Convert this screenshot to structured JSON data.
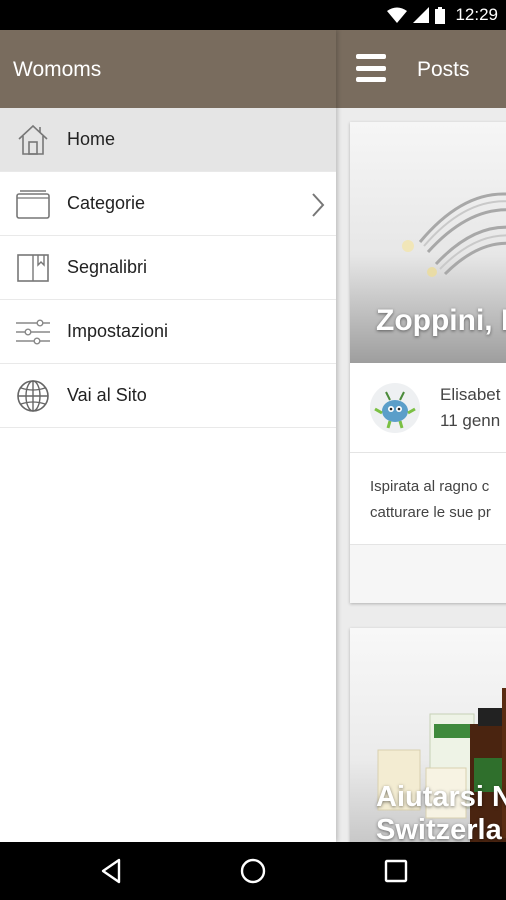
{
  "status_bar": {
    "time": "12:29",
    "icons": [
      "wifi-icon",
      "signal-icon",
      "battery-icon"
    ]
  },
  "drawer": {
    "title": "Womoms",
    "items": [
      {
        "label": "Home",
        "icon": "home-icon",
        "active": true
      },
      {
        "label": "Categorie",
        "icon": "folder-icon",
        "has_chevron": true
      },
      {
        "label": "Segnalibri",
        "icon": "bookmark-icon"
      },
      {
        "label": "Impostazioni",
        "icon": "sliders-icon"
      },
      {
        "label": "Vai al Sito",
        "icon": "globe-icon"
      }
    ]
  },
  "posts": {
    "title": "Posts",
    "cards": [
      {
        "title": "Zoppini, F",
        "author": "Elisabet",
        "date": "11 genn",
        "excerpt": [
          "Ispirata al ragno c",
          "catturare le sue pr"
        ]
      },
      {
        "title_lines": [
          "Aiutarsi N",
          "Switzerla"
        ]
      }
    ]
  },
  "nav_bar": {
    "buttons": [
      "back",
      "home",
      "recents"
    ]
  },
  "colors": {
    "app_bar": "#796c5e",
    "active_item": "#e5e5e5"
  }
}
